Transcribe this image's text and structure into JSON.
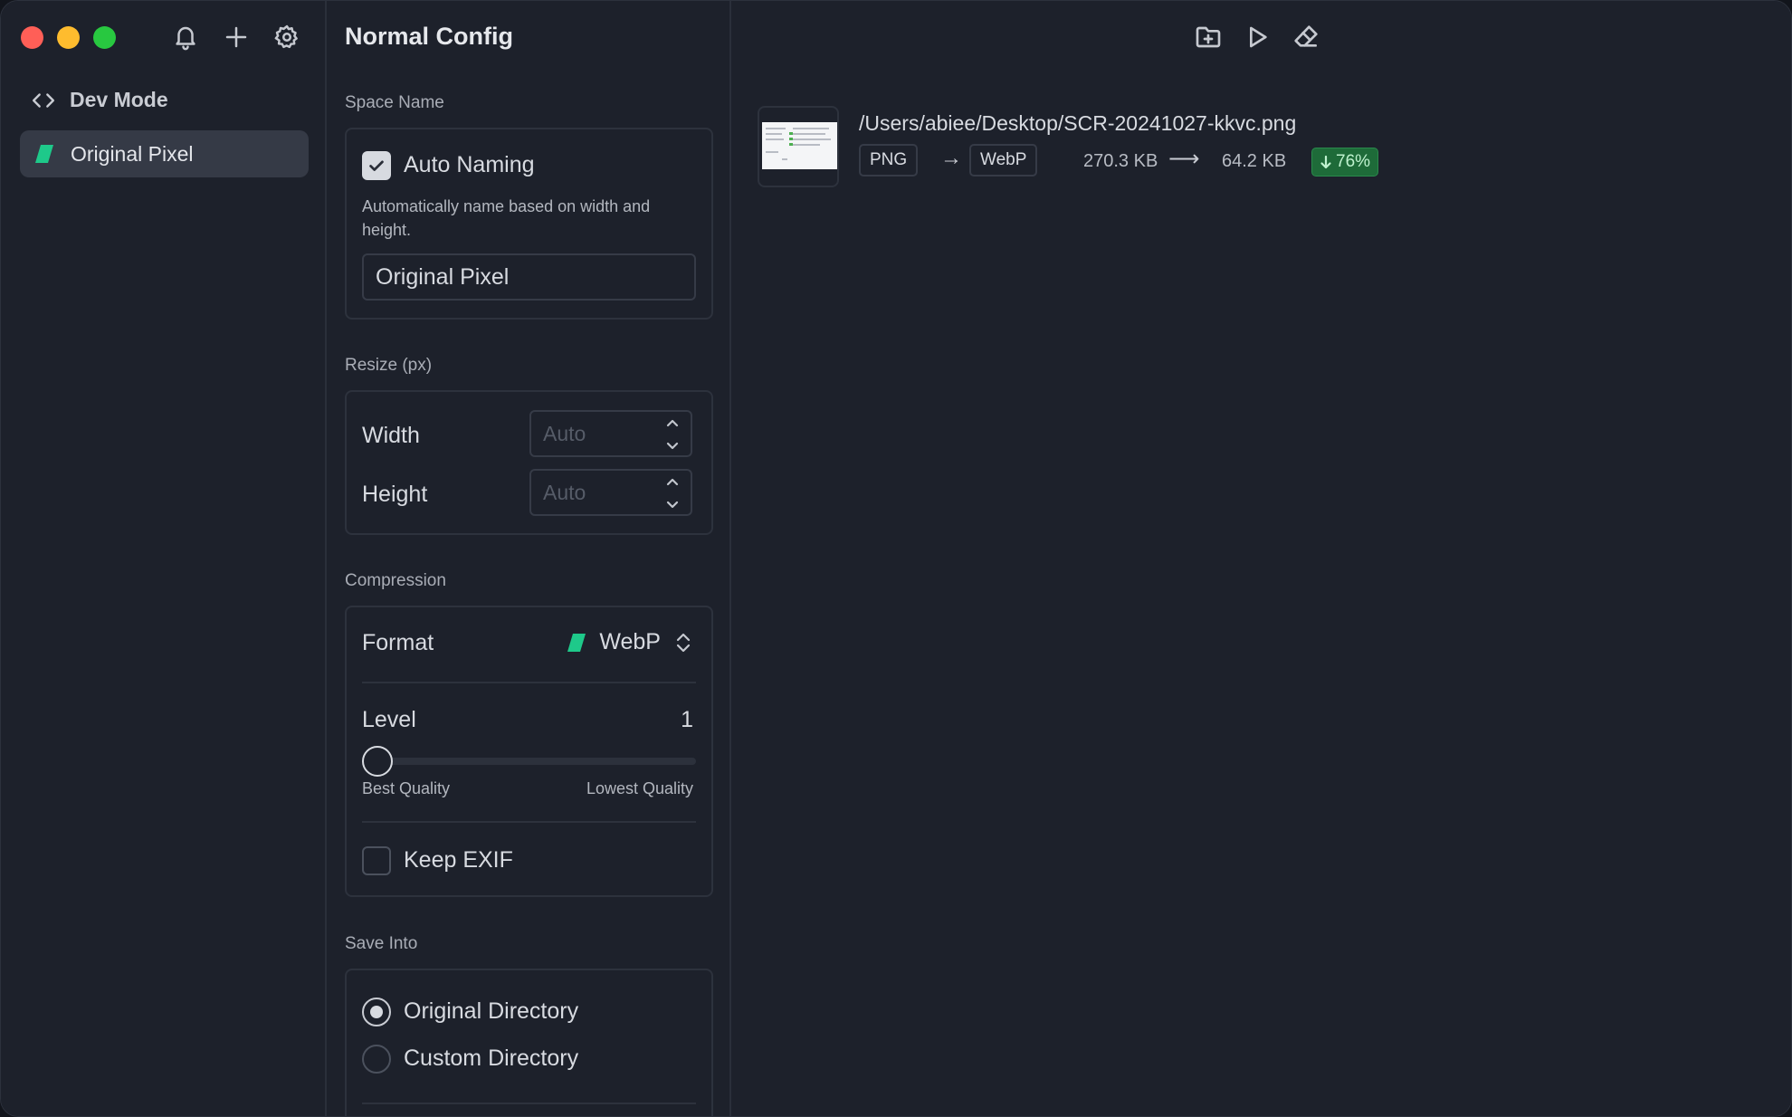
{
  "window": {
    "traffic_lights": {
      "close": "#ff5f57",
      "minimize": "#febc2e",
      "zoom": "#28c840"
    }
  },
  "sidebar": {
    "tools": [
      "bell-icon",
      "plus-icon",
      "gear-icon"
    ],
    "dev_mode_label": "Dev Mode",
    "spaces": [
      {
        "label": "Original Pixel",
        "icon": "parallelogram-icon",
        "color": "#1ec98a",
        "selected": true
      }
    ]
  },
  "config": {
    "title": "Normal Config",
    "space_name": {
      "label": "Space Name",
      "auto_naming_label": "Auto Naming",
      "auto_naming_checked": true,
      "help": "Automatically name based on width and height.",
      "name_value": "Original Pixel"
    },
    "resize": {
      "label": "Resize (px)",
      "width_label": "Width",
      "width_placeholder": "Auto",
      "height_label": "Height",
      "height_placeholder": "Auto"
    },
    "compression": {
      "label": "Compression",
      "format_label": "Format",
      "format_value": "WebP",
      "format_color": "#1ec98a",
      "level_label": "Level",
      "level_value": "1",
      "level_fraction": 0,
      "best_quality": "Best Quality",
      "lowest_quality": "Lowest Quality",
      "keep_exif_label": "Keep EXIF",
      "keep_exif_checked": false
    },
    "save_into": {
      "label": "Save Into",
      "options": [
        {
          "label": "Original Directory",
          "selected": true
        },
        {
          "label": "Custom Directory",
          "selected": false
        }
      ]
    }
  },
  "main": {
    "tools": [
      "folder-plus-icon",
      "play-icon",
      "eraser-icon"
    ],
    "files": [
      {
        "path": "/Users/abiee/Desktop/SCR-20241027-kkvc.png",
        "from_format": "PNG",
        "to_format": "WebP",
        "arrow": "→",
        "original_size": "270.3 KB",
        "size_arrow": "⟶",
        "new_size": "64.2 KB",
        "reduction": "76%",
        "badge_color": "#1e6b39"
      }
    ]
  }
}
